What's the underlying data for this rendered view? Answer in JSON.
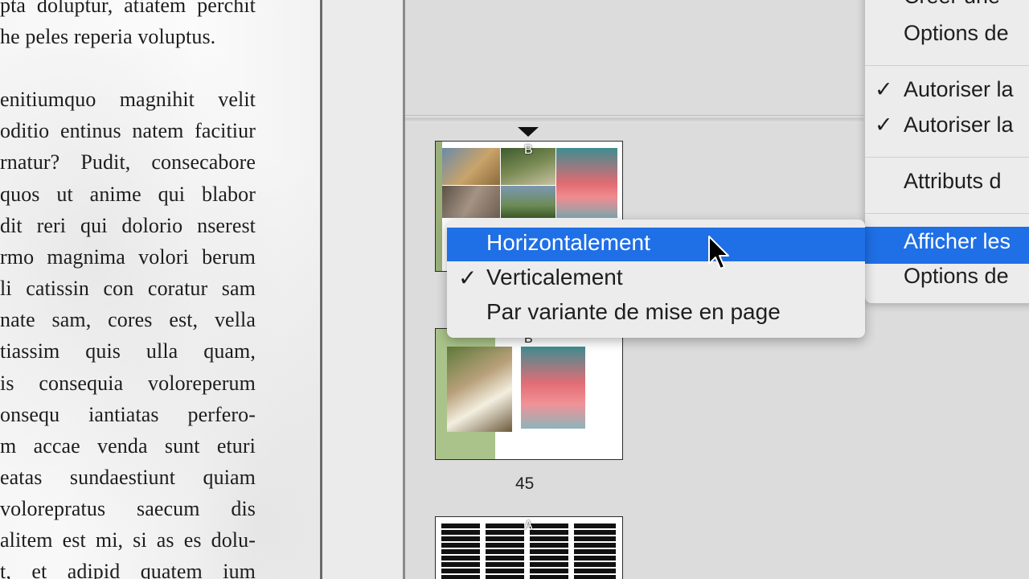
{
  "document": {
    "lines": [
      "pta doluptur, atiatem perchit",
      "he peles reperia voluptus.",
      "enitiumquo magnihit velit",
      "oditio entinus natem facitiur",
      "rnatur? Pudit, consecabore",
      "quos ut anime qui blabor",
      "dit reri qui dolorio nserest",
      "rmo magnima volori berum",
      "li catissin con coratur sam",
      "nate sam, cores est, vella",
      "tiassim quis ulla quam,",
      "is consequia voloreperum",
      "onsequ iantiatas perfero-",
      "m accae venda sunt eturi",
      "eatas sundaestiunt quiam",
      "volorepratus saecum dis",
      "alitem est mi, si as es dolu-",
      "t, et adipid quatem ium"
    ]
  },
  "pages_panel": {
    "thumb1_master": "B",
    "thumb2_master": "B",
    "thumb2_page_number": "45",
    "thumb3_master": "A"
  },
  "context_menu": {
    "items": [
      {
        "label": "Créer une",
        "checked": false
      },
      {
        "label": "Options de",
        "checked": false
      },
      {
        "label": "Autoriser la",
        "checked": true
      },
      {
        "label": "Autoriser la",
        "checked": true
      },
      {
        "label": "Attributs d",
        "checked": false
      },
      {
        "label": "Afficher les",
        "checked": false,
        "highlighted": true
      },
      {
        "label": "Options de",
        "checked": false
      }
    ],
    "check_glyph": "✓"
  },
  "submenu": {
    "items": [
      {
        "label": "Horizontalement",
        "checked": false,
        "highlighted": true
      },
      {
        "label": "Verticalement",
        "checked": true
      },
      {
        "label": "Par variante de mise en page",
        "checked": false
      }
    ],
    "check_glyph": "✓"
  },
  "colors": {
    "highlight": "#1f6fe6",
    "menu_bg": "#ececec"
  }
}
